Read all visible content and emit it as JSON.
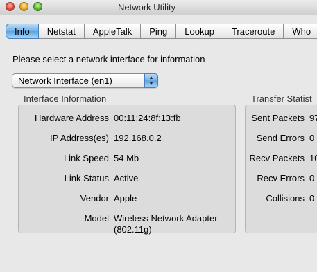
{
  "window": {
    "title": "Network Utility"
  },
  "tabs": [
    {
      "label": "Info",
      "selected": true
    },
    {
      "label": "Netstat",
      "selected": false
    },
    {
      "label": "AppleTalk",
      "selected": false
    },
    {
      "label": "Ping",
      "selected": false
    },
    {
      "label": "Lookup",
      "selected": false
    },
    {
      "label": "Traceroute",
      "selected": false
    },
    {
      "label": "Who",
      "selected": false
    }
  ],
  "prompt": "Please select a network interface for information",
  "interface_select": {
    "value": "Network Interface (en1)"
  },
  "interface_info": {
    "title": "Interface Information",
    "rows": [
      {
        "label": "Hardware Address",
        "value": "00:11:24:8f:13:fb"
      },
      {
        "label": "IP Address(es)",
        "value": "192.168.0.2"
      },
      {
        "label": "Link Speed",
        "value": "54 Mb"
      },
      {
        "label": "Link Status",
        "value": "Active"
      },
      {
        "label": "Vendor",
        "value": "Apple"
      },
      {
        "label": "Model",
        "value": "Wireless Network Adapter",
        "value2": "(802.11g)"
      }
    ]
  },
  "transfer_stats": {
    "title": "Transfer Statist",
    "rows": [
      {
        "label": "Sent Packets",
        "value": "97"
      },
      {
        "label": "Send Errors",
        "value": "0"
      },
      {
        "label": "Recv Packets",
        "value": "10"
      },
      {
        "label": "Recv Errors",
        "value": "0"
      },
      {
        "label": "Collisions",
        "value": "0"
      }
    ]
  },
  "colors": {
    "selected_tab": "#6fb0e8",
    "window_bg": "#e8e8e8",
    "box_bg": "#dcdcdc"
  }
}
